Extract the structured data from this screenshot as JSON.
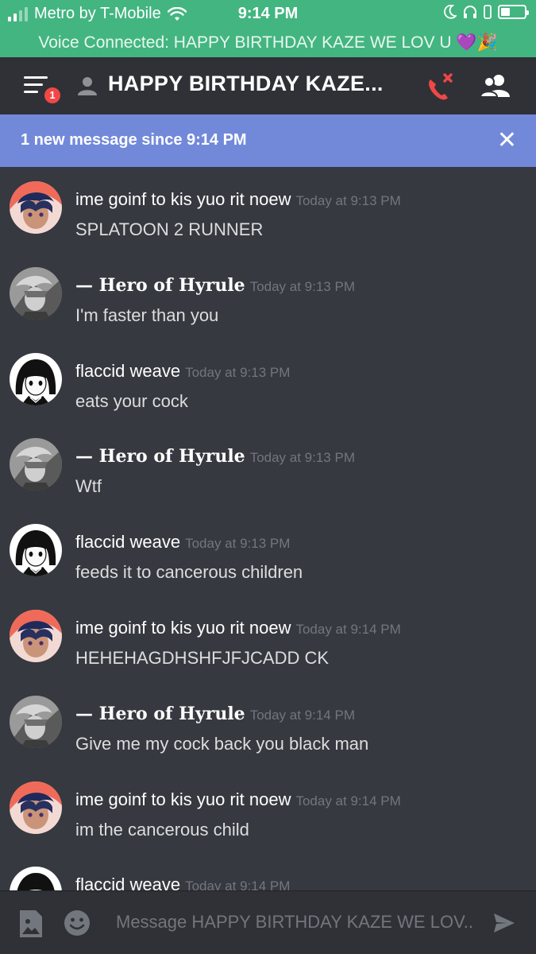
{
  "status_bar": {
    "carrier": "Metro by T-Mobile",
    "time": "9:14 PM"
  },
  "voice_bar": {
    "text": "Voice Connected: HAPPY BIRTHDAY KAZE WE LOV U 💜🎉"
  },
  "header": {
    "notification_count": "1",
    "channel_title": "HAPPY BIRTHDAY KAZE..."
  },
  "new_message_bar": {
    "text": "1 new message since 9:14 PM",
    "close_glyph": "✕"
  },
  "messages": [
    {
      "author": "ime goinf to kis yuo rit noew",
      "timestamp": "Today at 9:13 PM",
      "text": "SPLATOON 2 RUNNER",
      "avatar": "avatar-red"
    },
    {
      "author": "— Hero of Hyrule",
      "timestamp": "Today at 9:13 PM",
      "text": "I'm faster than you",
      "avatar": "avatar-gray"
    },
    {
      "author": "flaccid weave",
      "timestamp": "Today at 9:13 PM",
      "text": "eats your cock",
      "avatar": "avatar-bw"
    },
    {
      "author": "— Hero of Hyrule",
      "timestamp": "Today at 9:13 PM",
      "text": "Wtf",
      "avatar": "avatar-gray"
    },
    {
      "author": "flaccid weave",
      "timestamp": "Today at 9:13 PM",
      "text": "feeds it to cancerous children",
      "avatar": "avatar-bw"
    },
    {
      "author": "ime goinf to kis yuo rit noew",
      "timestamp": "Today at 9:14 PM",
      "text": "HEHEHAGDHSHFJFJCADD CK",
      "avatar": "avatar-red"
    },
    {
      "author": "— Hero of Hyrule",
      "timestamp": "Today at 9:14 PM",
      "text": "Give me my cock back you black man",
      "avatar": "avatar-gray"
    },
    {
      "author": "ime goinf to kis yuo rit noew",
      "timestamp": "Today at 9:14 PM",
      "text": "im the cancerous child",
      "avatar": "avatar-red"
    },
    {
      "author": "flaccid weave",
      "timestamp": "Today at 9:14 PM",
      "text": "",
      "avatar": "avatar-bw"
    }
  ],
  "input_bar": {
    "placeholder": "Message HAPPY BIRTHDAY KAZE WE LOV.."
  },
  "colors": {
    "status_green": "#43b581",
    "blurple": "#7289da",
    "background": "#36393f",
    "header_bg": "#2f3136",
    "hangup_red": "#f04747",
    "timestamp_gray": "#72767d"
  }
}
